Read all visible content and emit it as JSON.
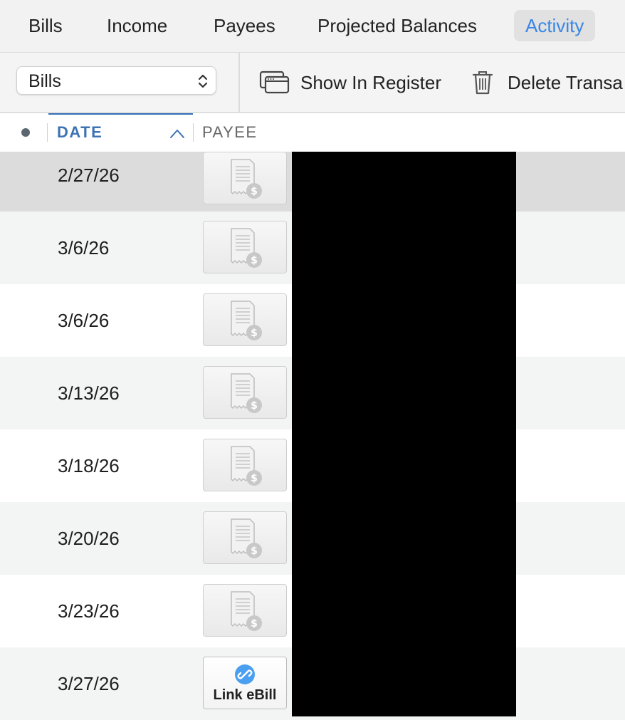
{
  "tabs": [
    {
      "label": "Bills",
      "active": false
    },
    {
      "label": "Income",
      "active": false
    },
    {
      "label": "Payees",
      "active": false
    },
    {
      "label": "Projected Balances",
      "active": false
    },
    {
      "label": "Activity",
      "active": true
    }
  ],
  "toolbar": {
    "filter_value": "Bills",
    "show_in_register_label": "Show In Register",
    "delete_label": "Delete Transa"
  },
  "columns": {
    "date_label": "DATE",
    "payee_label": "PAYEE",
    "sort_direction": "ascending"
  },
  "rows": [
    {
      "date": "2/27/26",
      "action": "bill-icon",
      "selected": true
    },
    {
      "date": "3/6/26",
      "action": "bill-icon"
    },
    {
      "date": "3/6/26",
      "action": "bill-icon"
    },
    {
      "date": "3/13/26",
      "action": "bill-icon"
    },
    {
      "date": "3/18/26",
      "action": "bill-icon"
    },
    {
      "date": "3/20/26",
      "action": "bill-icon"
    },
    {
      "date": "3/23/26",
      "action": "bill-icon"
    },
    {
      "date": "3/27/26",
      "action": "link-ebill",
      "label": "Link eBill"
    }
  ],
  "colors": {
    "accent": "#3a86e6",
    "header_accent": "#3e72b3",
    "redaction": "#000000"
  }
}
